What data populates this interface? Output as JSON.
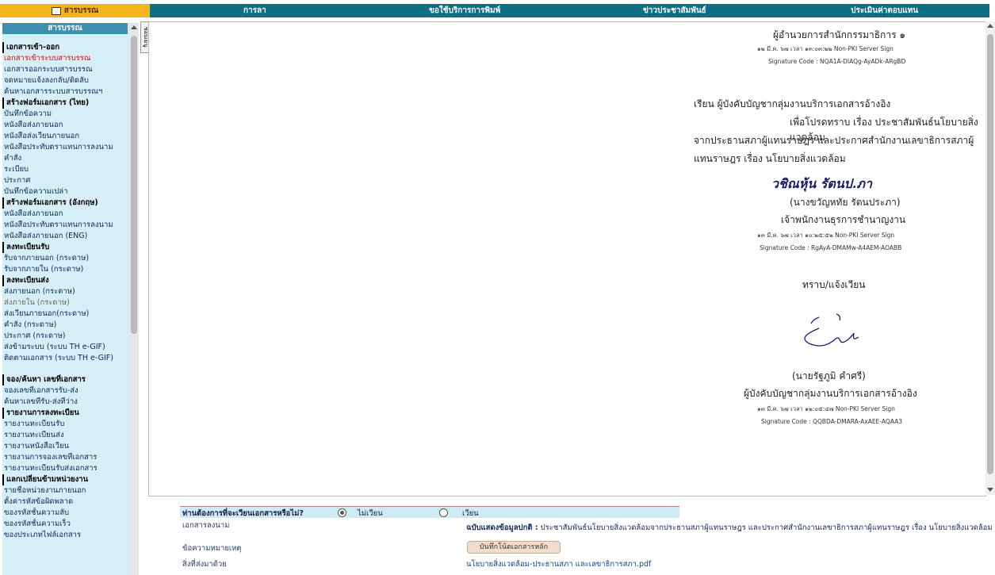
{
  "topnav": {
    "items": [
      {
        "label": "สารบรรณ",
        "active": true
      },
      {
        "label": "การลา"
      },
      {
        "label": "ขอใช้บริการการพิมพ์"
      },
      {
        "label": "ข่าวประชาสัมพันธ์"
      },
      {
        "label": "ประเมินค่าตอบแทน"
      }
    ]
  },
  "sidebar": {
    "title": "สารบรรณ",
    "collapse_tab": "ซ่อนเมนู",
    "items": [
      {
        "label": "เอกสารเข้า-ออก",
        "type": "hdr"
      },
      {
        "label": "เอกสารเข้าระบบสารบรรณ",
        "type": "red"
      },
      {
        "label": "เอกสารออกระบบสารบรรณ"
      },
      {
        "label": "จดหมายแจ้งลงกลับ/ติดลับ"
      },
      {
        "label": "ค้นหาเอกสารระบบสารบรรณฯ"
      },
      {
        "label": "สร้างฟอร์มเอกสาร (ไทย)",
        "type": "hdr"
      },
      {
        "label": "บันทึกข้อความ"
      },
      {
        "label": "หนังสือส่งภายนอก"
      },
      {
        "label": "หนังสือส่งเวียนภายนอก"
      },
      {
        "label": "หนังสือประทับตราแทนการลงนาม"
      },
      {
        "label": "คำสั่ง"
      },
      {
        "label": "ระเบียบ"
      },
      {
        "label": "ประกาศ"
      },
      {
        "label": "บันทึกข้อความเปล่า"
      },
      {
        "label": "สร้างฟอร์มเอกสาร (อังกฤษ)",
        "type": "hdr"
      },
      {
        "label": "หนังสือส่งภายนอก"
      },
      {
        "label": "หนังสือประทับตราแทนการลงนาม"
      },
      {
        "label": "หนังสือส่งภายนอก (ENG)"
      },
      {
        "label": "ลงทะเบียนรับ",
        "type": "hdr"
      },
      {
        "label": "รับจากภายนอก (กระดาษ)"
      },
      {
        "label": "รับจากภายใน (กระดาษ)"
      },
      {
        "label": "ลงทะเบียนส่ง",
        "type": "hdr"
      },
      {
        "label": "ส่งภายนอก (กระดาษ)"
      },
      {
        "label": "ส่งภายใน (กระดาษ)",
        "type": "gray"
      },
      {
        "label": "ส่งเวียนภายนอก(กระดาษ)"
      },
      {
        "label": "คำสั่ง (กระดาษ)"
      },
      {
        "label": "ประกาศ (กระดาษ)"
      },
      {
        "label": "ส่งข้ามระบบ (ระบบ TH e-GIF)"
      },
      {
        "label": "ติดตามเอกสาร (ระบบ TH e-GIF)",
        "type": "tall"
      },
      {
        "label": "จอง/ค้นหา เลขที่เอกสาร",
        "type": "hdr"
      },
      {
        "label": "จองเลขที่เอกสารรับ-ส่ง"
      },
      {
        "label": "ค้นหาเลขที่รับ-ส่งที่ว่าง"
      },
      {
        "label": "รายงานการลงทะเบียน",
        "type": "hdr"
      },
      {
        "label": "รายงานทะเบียนรับ"
      },
      {
        "label": "รายงานทะเบียนส่ง"
      },
      {
        "label": "รายงานหนังสือเวียน"
      },
      {
        "label": "รายงานการจองเลขที่เอกสาร"
      },
      {
        "label": "รายงานทะเบียนรับส่งเอกสาร"
      },
      {
        "label": "แลกเปลี่ยนข้ามหน่วยงาน",
        "type": "hdr"
      },
      {
        "label": "รายชื่อหน่วยงานภายนอก"
      },
      {
        "label": "ตั้งค่ารหัสข้อผิดพลาด"
      },
      {
        "label": "ของรหัสชั้นความลับ"
      },
      {
        "label": "ของรหัสชั้นความเร็ว"
      },
      {
        "label": "ของประเภทไฟล์เอกสาร"
      }
    ]
  },
  "document": {
    "block1": {
      "title": "ผู้อำนวยการสำนักกรรมาธิการ ๑",
      "stamp": "๑๒ มี.ค. ๖๗ เวลา ๑๓:๐๓:๒๒ Non-PKI Server Sign",
      "code": "Signature Code : NQA1A-DIAQg-AyADk-ARgBD"
    },
    "memo_line1": "เรียน  ผู้บังคับบัญชากลุ่มงานบริการเอกสารอ้างอิง",
    "memo_line2": "เพื่อโปรดทราบ เรื่อง ประชาสัมพันธ์นโยบายสิ่งแวดล้อม",
    "memo_line3": "จากประธานสภาผู้แทนราษฎร และประกาศสำนักงานเลขาธิการสภาผู้",
    "memo_line4": "แทนราษฎร เรื่อง นโยบายสิ่งแวดล้อม",
    "block2": {
      "signature": "วชิณหุ้น  รัตนป.ภา",
      "name": "(นางขวัญหทัย รัตนประภา)",
      "position": "เจ้าพนักงานธุรการชำนาญงาน",
      "stamp": "๑๓ มี.ค. ๖๗ เวลา ๑๐:๒๕:๕๒ Non-PKI Server Sign",
      "code": "Signature Code : RgAyA-DMAMw-A4AEM-AOABB"
    },
    "ack": "ทราบ/แจ้งเวียน",
    "block3": {
      "name": "(นายรัฐภูมิ คำศรี)",
      "position": "ผู้บังคับบัญชากลุ่มงานบริการเอกสารอ้างอิง",
      "stamp": "๑๓ มี.ค. ๖๗ เวลา ๑๒:๐๕:๔๗ Non-PKI Server Sign",
      "code": "Signature Code : QQBDA-DMARA-AxAEE-AQAA3"
    }
  },
  "form": {
    "question": "ท่านต้องการที่จะเวียนเอกสารหรือไม่?",
    "options": [
      {
        "label": "ไม่เวียน",
        "checked": true
      },
      {
        "label": "เวียน",
        "checked": false
      }
    ],
    "doc_name_label": "เอกสารลงนาม",
    "doc_name_prefix": "ฉบับแสดงข้อมูลปกติ :",
    "doc_name_value": "ประชาสัมพันธ์นโยบายสิ่งแวดล้อมจากประธานสภาผู้แทนราษฎร และประกาศสำนักงานเลขาธิการสภาผู้แทนราษฎร เรื่อง นโยบายสิ่งแวดล้อม",
    "note_label": "ข้อความหมายเหตุ",
    "note_button": "บันทึกโน้ตเอกสารหลัก",
    "attach_label": "สิ่งที่ส่งมาด้วย",
    "attach_link": "นโยบายสิ่งแวดล้อม-ประธานสภา และเลขาธิการสภา.pdf"
  }
}
